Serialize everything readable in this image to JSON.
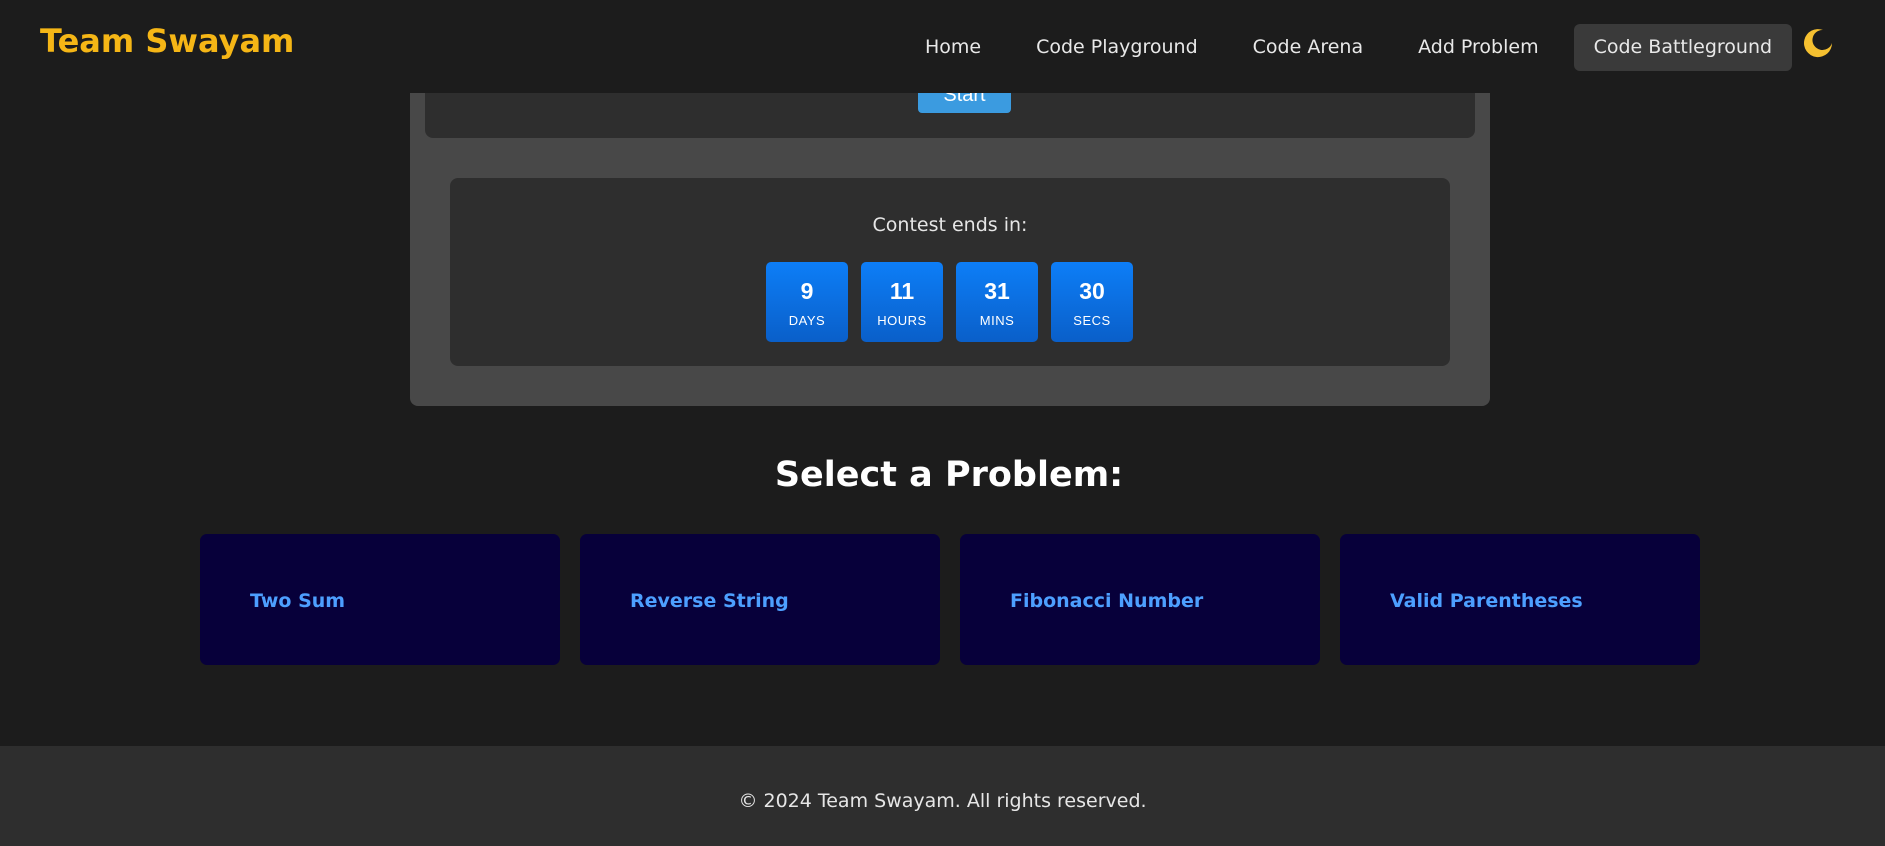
{
  "header": {
    "brand": "Team Swayam",
    "nav": [
      {
        "label": "Home"
      },
      {
        "label": "Code Playground"
      },
      {
        "label": "Code Arena"
      },
      {
        "label": "Add Problem"
      },
      {
        "label": "Code Battleground",
        "active": true
      }
    ],
    "theme_icon": "moon-icon",
    "colors": {
      "brand": "#f5b616",
      "background": "#1c1c1c",
      "active_nav": "#3a3a3a"
    }
  },
  "contest": {
    "start_label": "Start",
    "timer_label": "Contest ends in:",
    "countdown": [
      {
        "value": "9",
        "label": "DAYS"
      },
      {
        "value": "11",
        "label": "HOURS"
      },
      {
        "value": "31",
        "label": "MINS"
      },
      {
        "value": "30",
        "label": "SECS"
      }
    ],
    "colors": {
      "button": "#3b9be0",
      "unit": "#0d7ef7"
    }
  },
  "problems": {
    "title": "Select a Problem:",
    "items": [
      {
        "title": "Two Sum"
      },
      {
        "title": "Reverse String"
      },
      {
        "title": "Fibonacci Number"
      },
      {
        "title": "Valid Parentheses"
      }
    ],
    "colors": {
      "card": "#07003a",
      "text": "#4d9fff"
    }
  },
  "footer": {
    "text": "© 2024 Team Swayam. All rights reserved."
  }
}
